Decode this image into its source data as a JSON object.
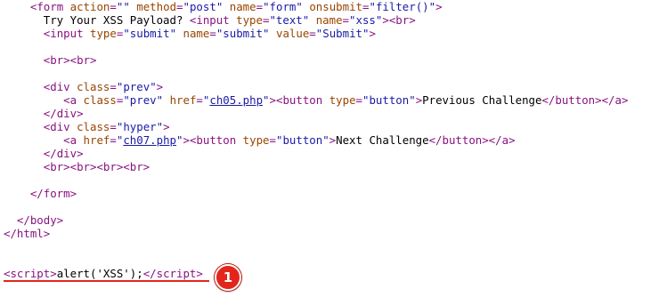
{
  "source": {
    "form_open": {
      "tag": "form",
      "action_attr": "action",
      "action_val": "",
      "method_attr": "method",
      "method_val": "post",
      "name_attr": "name",
      "name_val": "form",
      "onsubmit_attr": "onsubmit",
      "onsubmit_val": "filter()"
    },
    "prompt_text": "Try Your XSS Payload? ",
    "text_input": {
      "tag": "input",
      "type_attr": "type",
      "type_val": "text",
      "name_attr": "name",
      "name_val": "xss",
      "br_tag": "br"
    },
    "submit_input": {
      "tag": "input",
      "type_attr": "type",
      "type_val": "submit",
      "name_attr": "name",
      "name_val": "submit",
      "value_attr": "value",
      "value_val": "Submit"
    },
    "br_pair": "<br><br>",
    "prev_div": {
      "div_tag": "div",
      "class_attr": "class",
      "class_val": "prev",
      "a_tag": "a",
      "a_class_val": "prev",
      "href_attr": "href",
      "href_val": "ch05.php",
      "button_tag": "button",
      "button_type_val": "button",
      "button_text": "Previous Challenge"
    },
    "hyper_div": {
      "div_tag": "div",
      "class_attr": "class",
      "class_val": "hyper",
      "a_tag": "a",
      "href_attr": "href",
      "href_val": "ch07.php",
      "button_tag": "button",
      "button_type_val": "button",
      "button_text": "Next Challenge"
    },
    "br_quad": "<br><br><br><br>",
    "form_close": "</form>",
    "body_close": "</body>",
    "html_close": "</html>",
    "injected_script": {
      "open_tag": "script",
      "payload": "alert('XSS');",
      "close_tag": "/script"
    }
  },
  "badge": {
    "number": "1",
    "color": "#e3261b"
  },
  "colors": {
    "tag": "#881280",
    "attribute": "#994500",
    "value": "#1a1aa6"
  }
}
